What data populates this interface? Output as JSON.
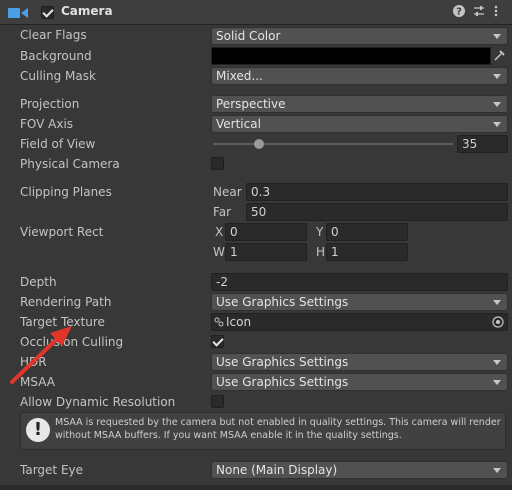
{
  "header": {
    "title": "Camera",
    "enabled": true,
    "icons": [
      "camera-icon",
      "help-icon",
      "presets-icon",
      "more-icon"
    ]
  },
  "rows": {
    "clear_flags": {
      "label": "Clear Flags",
      "value": "Solid Color"
    },
    "background": {
      "label": "Background",
      "color": "#000000"
    },
    "culling_mask": {
      "label": "Culling Mask",
      "value": "Mixed..."
    },
    "projection": {
      "label": "Projection",
      "value": "Perspective"
    },
    "fov_axis": {
      "label": "FOV Axis",
      "value": "Vertical"
    },
    "field_of_view": {
      "label": "Field of View",
      "value": "35",
      "slider_min": 1,
      "slider_max": 179
    },
    "physical_camera": {
      "label": "Physical Camera",
      "checked": false
    },
    "clipping_planes": {
      "label": "Clipping Planes",
      "near_label": "Near",
      "near": "0.3",
      "far_label": "Far",
      "far": "50"
    },
    "viewport_rect": {
      "label": "Viewport Rect",
      "x_label": "X",
      "x": "0",
      "y_label": "Y",
      "y": "0",
      "w_label": "W",
      "w": "1",
      "h_label": "H",
      "h": "1"
    },
    "depth": {
      "label": "Depth",
      "value": "-2"
    },
    "rendering_path": {
      "label": "Rendering Path",
      "value": "Use Graphics Settings"
    },
    "target_texture": {
      "label": "Target Texture",
      "value": "Icon"
    },
    "occlusion_culling": {
      "label": "Occlusion Culling",
      "checked": true
    },
    "hdr": {
      "label": "HDR",
      "value": "Use Graphics Settings"
    },
    "msaa": {
      "label": "MSAA",
      "value": "Use Graphics Settings"
    },
    "allow_dynamic_resolution": {
      "label": "Allow Dynamic Resolution",
      "checked": false
    },
    "target_eye": {
      "label": "Target Eye",
      "value": "None (Main Display)"
    }
  },
  "help": {
    "text": "MSAA is requested by the camera but not enabled in quality settings. This camera will render without MSAA buffers. If you want MSAA enable it in the quality settings."
  },
  "colors": {
    "annotation_arrow": "#e0352a",
    "panel_bg": "#383838"
  }
}
